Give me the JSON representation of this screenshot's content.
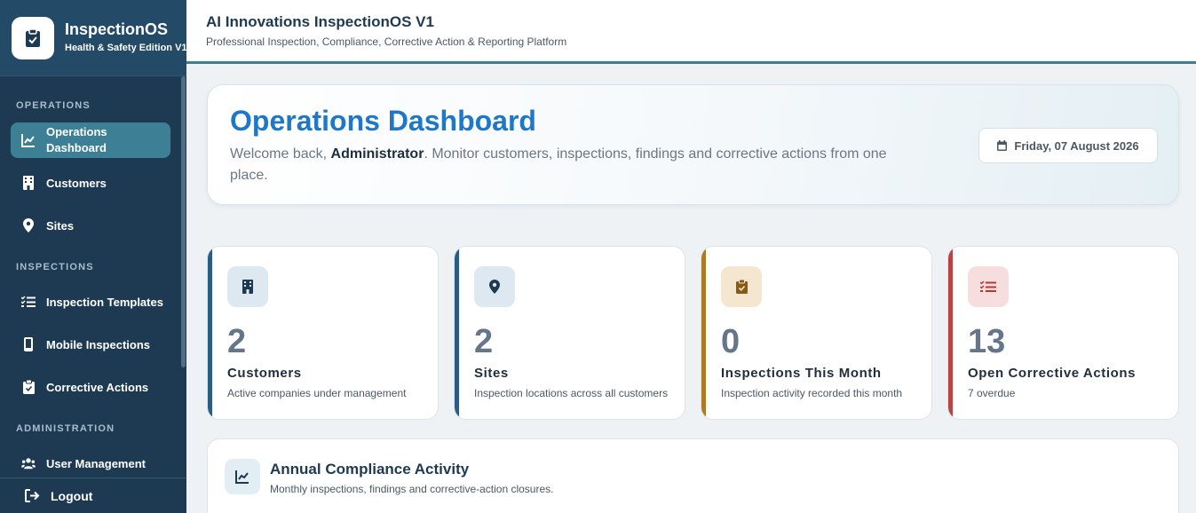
{
  "brand": {
    "title": "InspectionOS",
    "subtitle": "Health & Safety Edition V1",
    "logo_icon": "clipboard-check-icon"
  },
  "sidebar": {
    "sections": [
      {
        "label": "OPERATIONS",
        "items": [
          {
            "label": "Operations Dashboard",
            "icon": "chart-line-icon",
            "active": true
          },
          {
            "label": "Customers",
            "icon": "building-icon"
          },
          {
            "label": "Sites",
            "icon": "map-pin-icon"
          }
        ]
      },
      {
        "label": "INSPECTIONS",
        "items": [
          {
            "label": "Inspection Templates",
            "icon": "list-check-icon"
          },
          {
            "label": "Mobile Inspections",
            "icon": "mobile-icon"
          },
          {
            "label": "Corrective Actions",
            "icon": "clipboard-check-icon"
          }
        ]
      },
      {
        "label": "ADMINISTRATION",
        "items": [
          {
            "label": "User Management",
            "icon": "users-icon"
          }
        ]
      }
    ],
    "logout_label": "Logout"
  },
  "header": {
    "title": "AI Innovations InspectionOS V1",
    "subtitle": "Professional Inspection, Compliance, Corrective Action & Reporting Platform"
  },
  "hero": {
    "title": "Operations Dashboard",
    "welcome_prefix": "Welcome back, ",
    "user": "Administrator",
    "welcome_suffix": ". Monitor customers, inspections, findings and corrective actions from one place.",
    "date": "Friday, 07 August 2026"
  },
  "stats": [
    {
      "value": "2",
      "title": "Customers",
      "desc": "Active companies under management",
      "accent": "#2b5c86",
      "icon": "building-icon"
    },
    {
      "value": "2",
      "title": "Sites",
      "desc": "Inspection locations across all customers",
      "accent": "#2b5c86",
      "icon": "map-pin-icon"
    },
    {
      "value": "0",
      "title": "Inspections This Month",
      "desc": "Inspection activity recorded this month",
      "accent": "#b07a24",
      "icon": "clipboard-check-icon"
    },
    {
      "value": "13",
      "title": "Open Corrective Actions",
      "desc": "7 overdue",
      "accent": "#b84545",
      "icon": "list-check-icon"
    }
  ],
  "panel": {
    "title": "Annual Compliance Activity",
    "subtitle": "Monthly inspections, findings and corrective-action closures.",
    "icon": "chart-line-icon"
  }
}
